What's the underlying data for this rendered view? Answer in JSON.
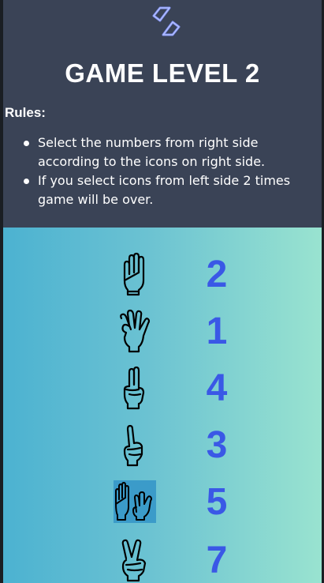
{
  "header": {
    "logo": "brand-logo-icon",
    "title": "GAME LEVEL 2",
    "rules_label": "Rules:",
    "rules": [
      "Select the numbers from right side according to the icons on right side.",
      "If you select icons from left side 2 times game will be over."
    ]
  },
  "game": {
    "rows": [
      {
        "icon": "open-hand-icon",
        "number": "2",
        "selected": false
      },
      {
        "icon": "three-fingers-icon",
        "number": "1",
        "selected": false
      },
      {
        "icon": "two-fingers-icon",
        "number": "4",
        "selected": false
      },
      {
        "icon": "pointing-finger-icon",
        "number": "3",
        "selected": false
      },
      {
        "icon": "two-hands-icon",
        "number": "5",
        "selected": true
      },
      {
        "icon": "victory-hand-icon",
        "number": "7",
        "selected": false
      }
    ]
  },
  "colors": {
    "header_bg": "#3a4356",
    "number_color": "#3a58e6",
    "selected_bg": "#3b9bc9",
    "gradient_start": "#4cb2d1",
    "gradient_end": "#99e3d0"
  }
}
